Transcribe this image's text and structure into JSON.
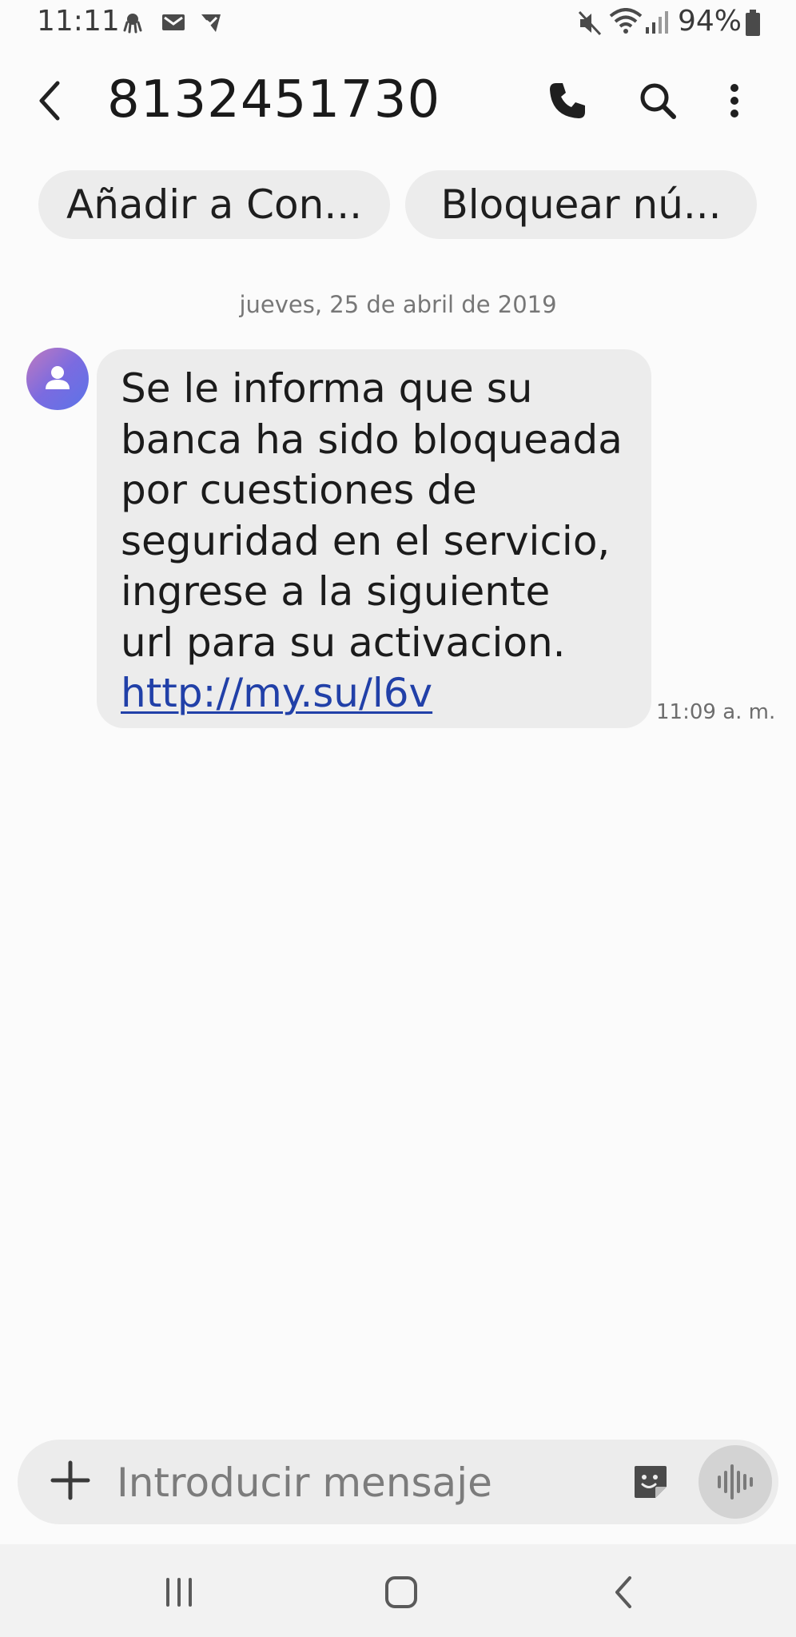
{
  "status_bar": {
    "time": "11:11",
    "battery_percent": "94%",
    "left_icons": [
      "octopus-icon",
      "gmail-icon",
      "send-check-icon"
    ],
    "right_icons": [
      "mute-icon",
      "wifi-icon",
      "signal-icon",
      "battery-icon"
    ]
  },
  "header": {
    "title": "8132451730",
    "icons": [
      "back-arrow-icon",
      "phone-icon",
      "search-icon",
      "more-options-icon"
    ]
  },
  "actions": {
    "add_contact": "Añadir a Con...",
    "block_number": "Bloquear nú..."
  },
  "conversation": {
    "date_separator": "jueves, 25 de abril de 2019",
    "message": {
      "lines": [
        "Se le informa que su",
        "banca ha sido bloqueada",
        "por cuestiones de",
        "seguridad en el servicio,",
        "ingrese a la siguiente",
        "url para su activacion."
      ],
      "link": "http://my.su/l6v",
      "time": "11:09 a. m."
    }
  },
  "composer": {
    "placeholder": "Introducir mensaje",
    "value": "",
    "icons": [
      "plus-icon",
      "sticker-icon",
      "voice-icon"
    ]
  },
  "colors": {
    "background": "#fbfbfb",
    "bubble": "#ececec",
    "link": "#2140a8",
    "avatar_gradient": [
      "#c07abf",
      "#5b74e8"
    ]
  }
}
